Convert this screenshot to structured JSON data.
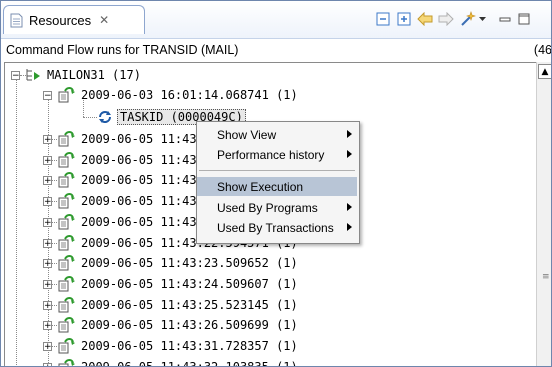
{
  "tab": {
    "label": "Resources",
    "close": "✕"
  },
  "subtitle": "Command Flow runs for TRANSID (MAIL)",
  "total_count": "(46",
  "tree": {
    "root": {
      "label": "MAILON31 (17)"
    },
    "run1": {
      "label": "2009-06-03 16:01:14.068741 (1)"
    },
    "taskid": {
      "label": "TASKID (0000049C)"
    },
    "runs": [
      "2009-06-05 11:43",
      "2009-06-05 11:43",
      "2009-06-05 11:43",
      "2009-06-05 11:43",
      "2009-06-05 11:43",
      "2009-06-05 11:43:22.594571 (1)",
      "2009-06-05 11:43:23.509652 (1)",
      "2009-06-05 11:43:24.509607 (1)",
      "2009-06-05 11:43:25.523145 (1)",
      "2009-06-05 11:43:26.509699 (1)",
      "2009-06-05 11:43:31.728357 (1)",
      "2009-06-05 11:43:32.103835 (1)"
    ]
  },
  "context_menu": {
    "items": [
      {
        "label": "Show View"
      },
      {
        "label": "Performance history"
      },
      {
        "label": "Show Execution"
      },
      {
        "label": "Used By Programs"
      },
      {
        "label": "Used By Transactions"
      }
    ]
  },
  "colors": {
    "accent_blue": "#3c78c8",
    "highlight": "#b8c5d6",
    "run_icon_green": "#2e9a2e"
  }
}
